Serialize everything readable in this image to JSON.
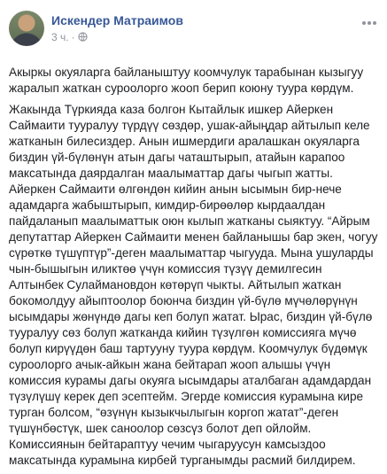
{
  "post": {
    "author": "Искендер Матраимов",
    "time": "3 ч.",
    "separator": "·",
    "menu_icon": "more-horizontal-icon",
    "privacy_icon": "globe-icon",
    "paragraphs": [
      "Акыркы окуяларга байланыштуу коомчулук тарабынан кызыгуу жаралып жаткан суроолорго жооп берип коюну туура көрдүм.",
      "Жакында Түркияда каза болгон Кытайлык ишкер Айеркен Саймаити тууралуу түрдүү сөздөр, ушак-айыңдар айтылып келе жатканын билесиздер. Анын ишмердиги аралашкан окуяларга биздин үй-бүлөнүн атын дагы чаташтырып, атайын карапоо максатында даярдалган маалыматтар дагы чыгып жатты. Айеркен Саймаити өлгөндөн кийин анын ысымын бир-нече адамдарга жабыштырып, кимдир-бирөөлөр кырдаалдан пайдаланып маалыматтык оюн кылып жатканы сыяктуу. “Айрым депутаттар Айеркен Саймаити менен байланышы бар экен, чогуу сүрөткө түшүптүр”-деген маалыматтар чыгууда. Мына ушуларды чын-бышыгын иликтөө үчүн комиссия түзүү демилгесин Алтынбек Сулаймановдон көтөрүп чыкты. Айтылып жаткан бокомолдуу айыптоолор боюнча биздин үй-бүлө мүчөлөрүнүн ысымдары жөнүндө дагы кеп болуп жатат. Ырас, биздин үй-бүлө тууралуу сөз болуп жатканда кийин түзүлгөн комиссияга мүчө болуп кирүүдөн баш тартууну туура көрдүм. Коомчулук бүдөмүк суроолорго ачык-айкын жана бейтарап жооп алышы үчүн комиссия курамы дагы окуяга ысымдары аталбаган адамдардан түзүлүшү керек деп эсептейм. Эгерде комиссия курамына кире турган болсом, “өзүнүн кызыкчылыгын коргоп жатат”-деген түшүнбөстүк, шек саноолор сөзсүз болот деп ойлойм. Комиссиянын бейтараптуу чечим чыгаруусун камсыздоо максатында курамына кирбей турганымды расмий билдирем."
    ]
  }
}
